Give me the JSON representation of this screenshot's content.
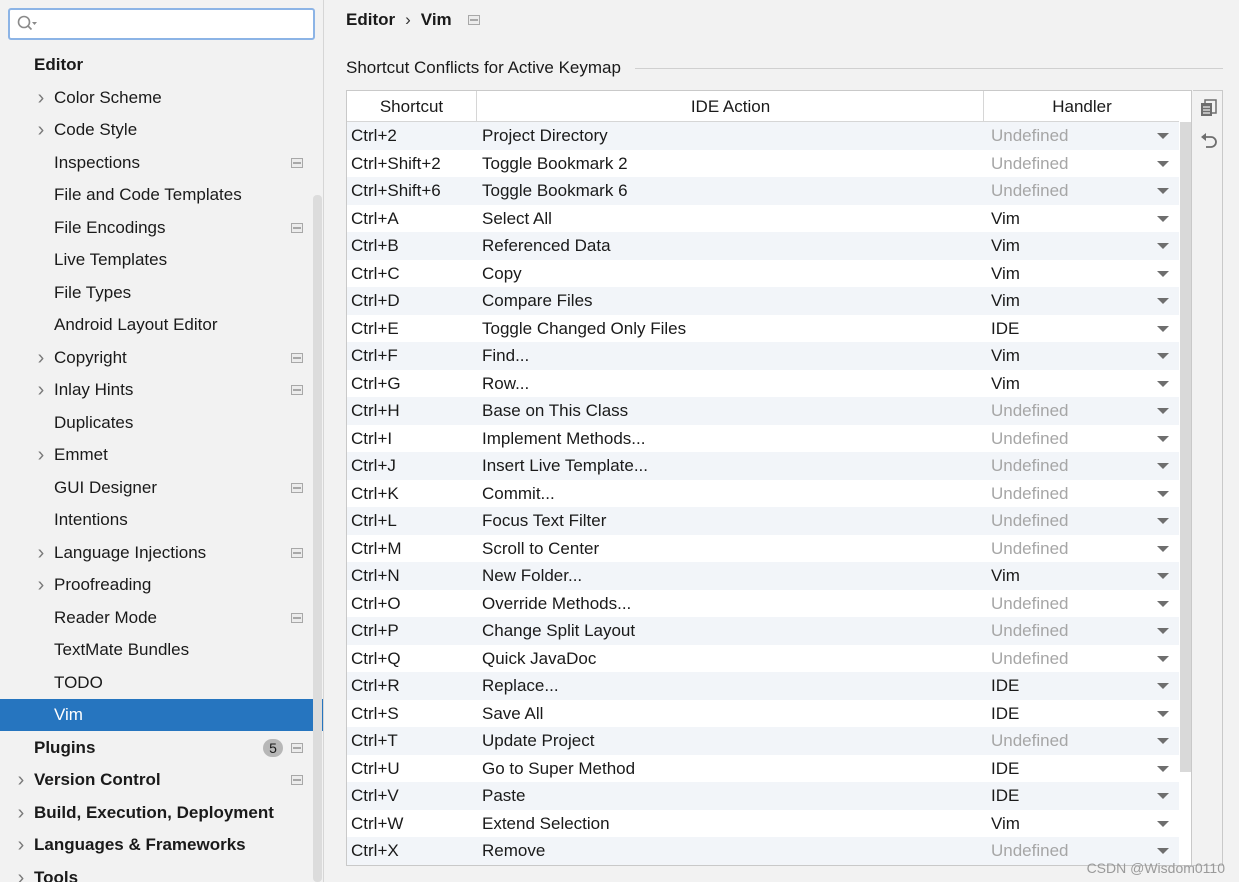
{
  "search": {
    "placeholder": "",
    "value": ""
  },
  "sidebar": {
    "items": [
      {
        "label": "Editor",
        "bold": true,
        "indent": 0,
        "chevron": false
      },
      {
        "label": "Color Scheme",
        "indent": 1,
        "chevron": true
      },
      {
        "label": "Code Style",
        "indent": 1,
        "chevron": true
      },
      {
        "label": "Inspections",
        "indent": 1,
        "chevron": false,
        "project_icon": true
      },
      {
        "label": "File and Code Templates",
        "indent": 1,
        "chevron": false
      },
      {
        "label": "File Encodings",
        "indent": 1,
        "chevron": false,
        "project_icon": true
      },
      {
        "label": "Live Templates",
        "indent": 1,
        "chevron": false
      },
      {
        "label": "File Types",
        "indent": 1,
        "chevron": false
      },
      {
        "label": "Android Layout Editor",
        "indent": 1,
        "chevron": false
      },
      {
        "label": "Copyright",
        "indent": 1,
        "chevron": true,
        "project_icon": true
      },
      {
        "label": "Inlay Hints",
        "indent": 1,
        "chevron": true,
        "project_icon": true
      },
      {
        "label": "Duplicates",
        "indent": 1,
        "chevron": false
      },
      {
        "label": "Emmet",
        "indent": 1,
        "chevron": true
      },
      {
        "label": "GUI Designer",
        "indent": 1,
        "chevron": false,
        "project_icon": true
      },
      {
        "label": "Intentions",
        "indent": 1,
        "chevron": false
      },
      {
        "label": "Language Injections",
        "indent": 1,
        "chevron": true,
        "project_icon": true
      },
      {
        "label": "Proofreading",
        "indent": 1,
        "chevron": true
      },
      {
        "label": "Reader Mode",
        "indent": 1,
        "chevron": false,
        "project_icon": true
      },
      {
        "label": "TextMate Bundles",
        "indent": 1,
        "chevron": false
      },
      {
        "label": "TODO",
        "indent": 1,
        "chevron": false
      },
      {
        "label": "Vim",
        "indent": 1,
        "chevron": false,
        "selected": true
      },
      {
        "label": "Plugins",
        "bold": true,
        "indent": 0,
        "chevron": false,
        "badge": "5",
        "project_icon": true
      },
      {
        "label": "Version Control",
        "bold": true,
        "indent": 0,
        "chevron": true,
        "project_icon": true
      },
      {
        "label": "Build, Execution, Deployment",
        "bold": true,
        "indent": 0,
        "chevron": true
      },
      {
        "label": "Languages & Frameworks",
        "bold": true,
        "indent": 0,
        "chevron": true
      },
      {
        "label": "Tools",
        "bold": true,
        "indent": 0,
        "chevron": true
      }
    ]
  },
  "breadcrumb": {
    "parent": "Editor",
    "separator": "›",
    "current": "Vim"
  },
  "section": {
    "title": "Shortcut Conflicts for Active Keymap"
  },
  "table": {
    "columns": [
      "Shortcut",
      "IDE Action",
      "Handler"
    ],
    "rows": [
      {
        "shortcut": "Ctrl+2",
        "action": "Project Directory",
        "handler": "Undefined"
      },
      {
        "shortcut": "Ctrl+Shift+2",
        "action": "Toggle Bookmark 2",
        "handler": "Undefined"
      },
      {
        "shortcut": "Ctrl+Shift+6",
        "action": "Toggle Bookmark 6",
        "handler": "Undefined"
      },
      {
        "shortcut": "Ctrl+A",
        "action": "Select All",
        "handler": "Vim"
      },
      {
        "shortcut": "Ctrl+B",
        "action": "Referenced Data",
        "handler": "Vim"
      },
      {
        "shortcut": "Ctrl+C",
        "action": "Copy",
        "handler": "Vim"
      },
      {
        "shortcut": "Ctrl+D",
        "action": "Compare Files",
        "handler": "Vim"
      },
      {
        "shortcut": "Ctrl+E",
        "action": "Toggle Changed Only Files",
        "handler": "IDE"
      },
      {
        "shortcut": "Ctrl+F",
        "action": "Find...",
        "handler": "Vim"
      },
      {
        "shortcut": "Ctrl+G",
        "action": "Row...",
        "handler": "Vim"
      },
      {
        "shortcut": "Ctrl+H",
        "action": "Base on This Class",
        "handler": "Undefined"
      },
      {
        "shortcut": "Ctrl+I",
        "action": "Implement Methods...",
        "handler": "Undefined"
      },
      {
        "shortcut": "Ctrl+J",
        "action": "Insert Live Template...",
        "handler": "Undefined"
      },
      {
        "shortcut": "Ctrl+K",
        "action": "Commit...",
        "handler": "Undefined"
      },
      {
        "shortcut": "Ctrl+L",
        "action": "Focus Text Filter",
        "handler": "Undefined"
      },
      {
        "shortcut": "Ctrl+M",
        "action": "Scroll to Center",
        "handler": "Undefined"
      },
      {
        "shortcut": "Ctrl+N",
        "action": "New Folder...",
        "handler": "Vim"
      },
      {
        "shortcut": "Ctrl+O",
        "action": "Override Methods...",
        "handler": "Undefined"
      },
      {
        "shortcut": "Ctrl+P",
        "action": "Change Split Layout",
        "handler": "Undefined"
      },
      {
        "shortcut": "Ctrl+Q",
        "action": "Quick JavaDoc",
        "handler": "Undefined"
      },
      {
        "shortcut": "Ctrl+R",
        "action": "Replace...",
        "handler": "IDE"
      },
      {
        "shortcut": "Ctrl+S",
        "action": "Save All",
        "handler": "IDE"
      },
      {
        "shortcut": "Ctrl+T",
        "action": "Update Project",
        "handler": "Undefined"
      },
      {
        "shortcut": "Ctrl+U",
        "action": "Go to Super Method",
        "handler": "IDE"
      },
      {
        "shortcut": "Ctrl+V",
        "action": "Paste",
        "handler": "IDE"
      },
      {
        "shortcut": "Ctrl+W",
        "action": "Extend Selection",
        "handler": "Vim"
      },
      {
        "shortcut": "Ctrl+X",
        "action": "Remove",
        "handler": "Undefined"
      }
    ]
  },
  "toolbar": {
    "copy_icon": "copy-icon",
    "reset_icon": "undo-icon"
  },
  "watermark": "CSDN @Wisdom0110",
  "colors": {
    "selection": "#2675bf",
    "undefined_text": "#a6a6a6",
    "search_border": "#8cb4e6"
  }
}
